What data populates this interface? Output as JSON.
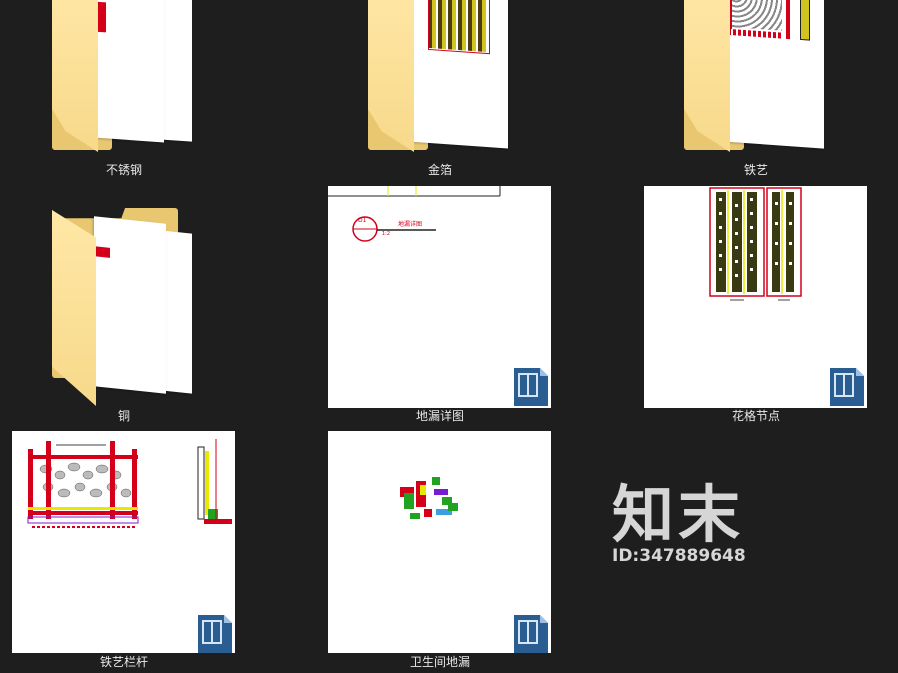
{
  "items": [
    {
      "name": "不锈钢",
      "type": "folder"
    },
    {
      "name": "金箔",
      "type": "folder"
    },
    {
      "name": "铁艺",
      "type": "folder"
    },
    {
      "name": "铜",
      "type": "folder"
    },
    {
      "name": "地漏详图",
      "type": "dwg"
    },
    {
      "name": "花格节点",
      "type": "dwg"
    },
    {
      "name": "铁艺栏杆",
      "type": "dwg"
    },
    {
      "name": "卫生间地漏",
      "type": "dwg"
    }
  ],
  "watermark": {
    "brand": "知末",
    "id": "ID:347889648"
  },
  "drawing_text": {
    "detail_tag": "D1",
    "detail_title": "地漏详图",
    "detail_scale": "1:2"
  },
  "icons": {
    "file_type": "dwg-file-icon"
  },
  "colors": {
    "background": "#1e1e1e",
    "folder": "#f7d98a",
    "cad_red": "#d4001a",
    "cad_yellow": "#ffff00"
  }
}
